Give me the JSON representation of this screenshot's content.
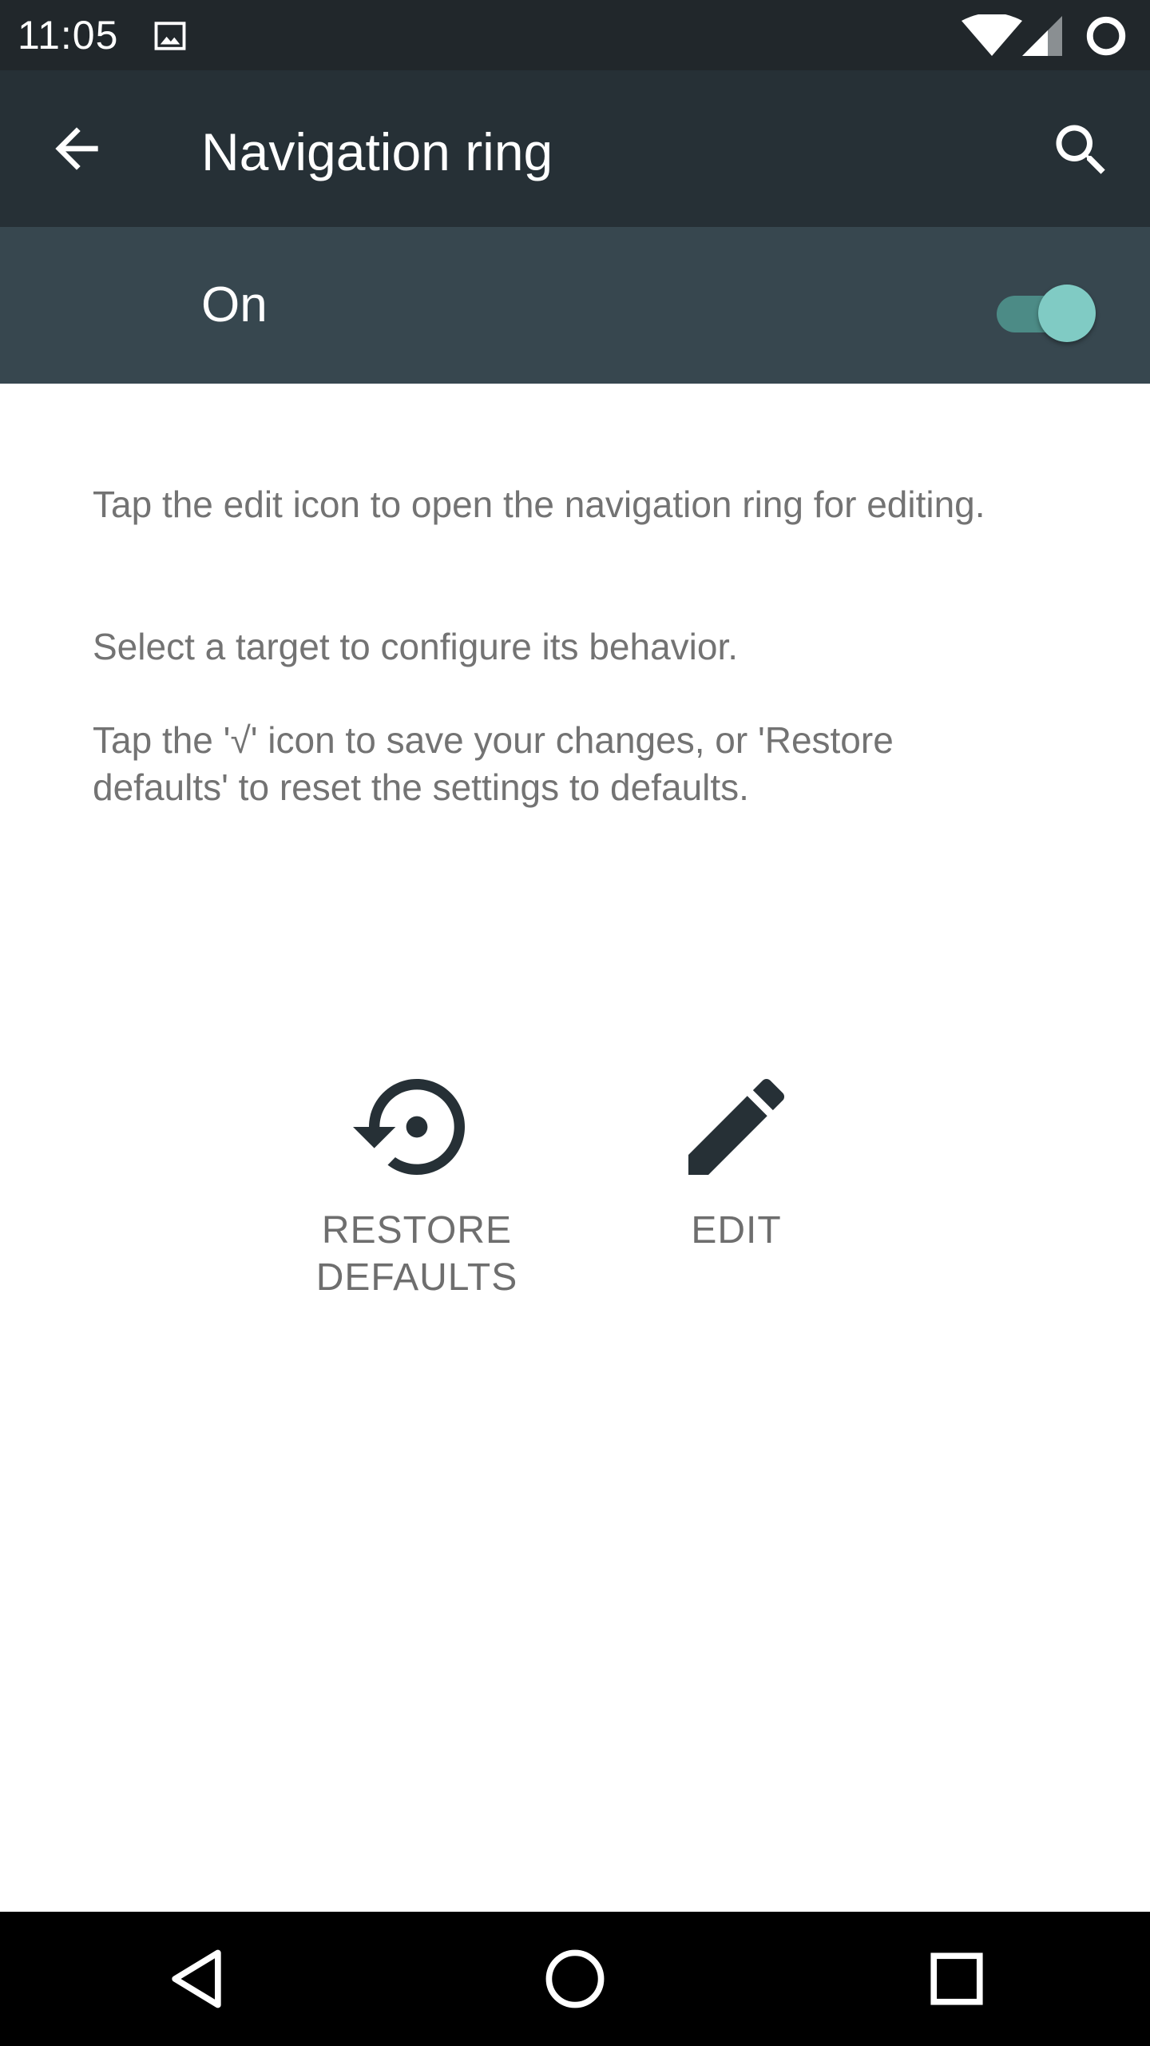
{
  "status_bar": {
    "time": "11:05",
    "icons": [
      "gallery-icon",
      "wifi-icon",
      "signal-icon",
      "battery-icon"
    ]
  },
  "toolbar": {
    "title": "Navigation ring",
    "back_icon": "arrow-back-icon",
    "search_icon": "search-icon"
  },
  "switch_bar": {
    "label": "On",
    "checked": true,
    "track_color": "#4c8b86",
    "thumb_color": "#80cbc4"
  },
  "instructions": [
    "Tap the edit icon to open the navigation ring for editing.",
    "Select a target to configure its behavior.",
    "Tap the '√' icon to save your changes, or 'Restore defaults' to reset the settings to defaults."
  ],
  "actions": {
    "restore": {
      "label": "RESTORE\nDEFAULTS",
      "icon": "restore-icon"
    },
    "edit": {
      "label": "EDIT",
      "icon": "pencil-icon"
    }
  },
  "nav_bar": {
    "icons": [
      "back-triangle-icon",
      "home-circle-icon",
      "recents-square-icon"
    ]
  },
  "colors": {
    "status_bar": "#21272b",
    "toolbar": "#263036",
    "switch_bar": "#37474f",
    "body_text": "#737373",
    "icon_dark": "#263036"
  }
}
